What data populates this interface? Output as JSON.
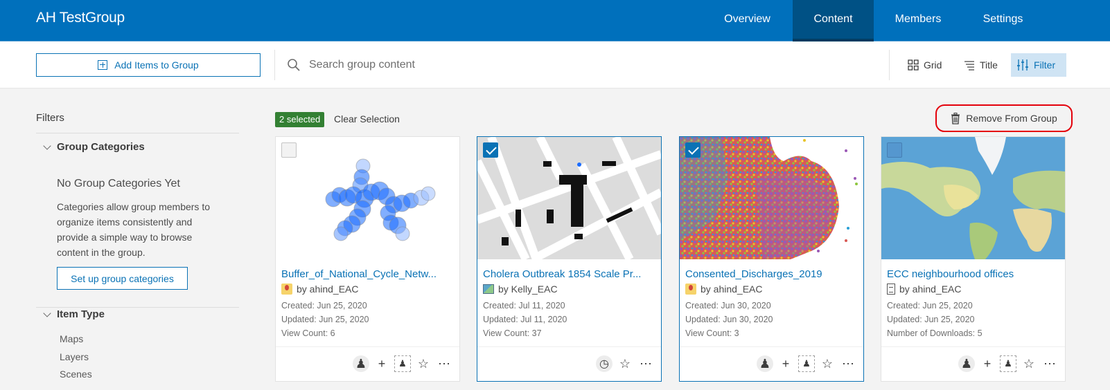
{
  "header": {
    "title": "AH TestGroup",
    "tabs": [
      {
        "label": "Overview",
        "active": false
      },
      {
        "label": "Content",
        "active": true
      },
      {
        "label": "Members",
        "active": false
      },
      {
        "label": "Settings",
        "active": false
      }
    ]
  },
  "toolbar": {
    "add_label": "Add Items to Group",
    "search_placeholder": "Search group content",
    "search_value": "",
    "grid_label": "Grid",
    "title_label": "Title",
    "filter_label": "Filter"
  },
  "sidebar": {
    "title": "Filters",
    "group_categories": {
      "label": "Group Categories",
      "empty_title": "No Group Categories Yet",
      "empty_desc": "Categories allow group members to organize items consistently and provide a simple way to browse content in the group.",
      "setup_label": "Set up group categories"
    },
    "item_type": {
      "label": "Item Type",
      "items": [
        "Maps",
        "Layers",
        "Scenes"
      ]
    }
  },
  "selection": {
    "badge": "2 selected",
    "clear_label": "Clear Selection",
    "remove_label": "Remove From Group"
  },
  "colors": {
    "brand": "#0070bc",
    "active_tab": "#005185",
    "accent": "#0a72b5",
    "selected_badge": "#338033",
    "highlight_ring": "#e4000b"
  },
  "cards": [
    {
      "title": "Buffer_of_National_Cycle_Netw...",
      "owner": "by ahind_EAC",
      "type_icon": "feature-layer-icon",
      "created": "Created: Jun 25, 2020",
      "updated": "Updated: Jun 25, 2020",
      "stat": "View Count: 6",
      "selected": false,
      "thumbnail": "blue-buffer-circles"
    },
    {
      "title": "Cholera Outbreak 1854 Scale Pr...",
      "owner": "by Kelly_EAC",
      "type_icon": "tile-layer-icon",
      "created": "Created: Jul 11, 2020",
      "updated": "Updated: Jul 11, 2020",
      "stat": "View Count: 37",
      "selected": true,
      "thumbnail": "historic-street-map"
    },
    {
      "title": "Consented_Discharges_2019",
      "owner": "by ahind_EAC",
      "type_icon": "feature-layer-icon",
      "created": "Created: Jun 30, 2020",
      "updated": "Updated: Jun 30, 2020",
      "stat": "View Count: 3",
      "selected": true,
      "thumbnail": "multicolor-point-cluster"
    },
    {
      "title": "ECC neighbourhood offices",
      "owner": "by ahind_EAC",
      "type_icon": "document-icon",
      "created": "Created: Jun 25, 2020",
      "updated": "Updated: Jun 25, 2020",
      "stat": "Number of Downloads: 5",
      "selected": false,
      "thumbnail": "world-imagery-map"
    }
  ]
}
